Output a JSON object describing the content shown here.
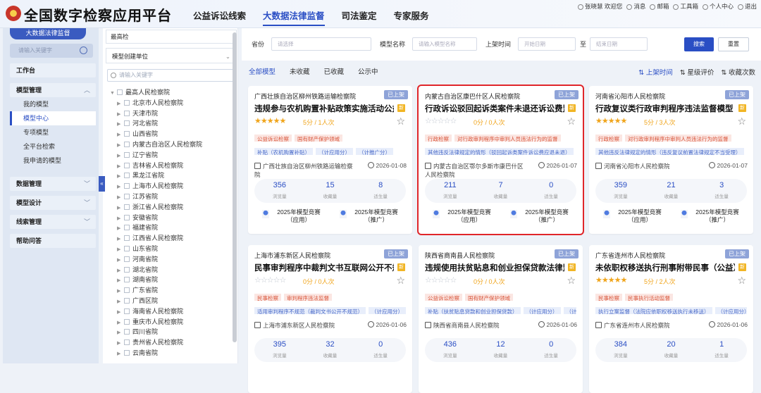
{
  "header": {
    "app_title": "全国数字检察应用平台",
    "nav": [
      "公益诉讼线索",
      "大数据法律监督",
      "司法鉴定",
      "专家服务"
    ],
    "active_nav": 1,
    "user": "张晓慧 欢迎您",
    "links": [
      "消息",
      "邮箱",
      "工具箱",
      "个人中心",
      "退出"
    ]
  },
  "sidebar": {
    "top_label": "大数据法律监督",
    "search_placeholder": "请输入关键字",
    "workbench": "工作台",
    "model_mgmt": "模型管理",
    "model_items": [
      "我的模型",
      "模型中心",
      "专项模型",
      "全平台检索",
      "我申请的模型"
    ],
    "active_item": 1,
    "data_mgmt": "数据管理",
    "model_design": "模型设计",
    "clue_mgmt": "线索管理",
    "help": "帮助问答"
  },
  "tree": {
    "select_value": "最高检",
    "label": "模型创建单位",
    "search_placeholder": "请输入关键字",
    "root": "最高人民检察院",
    "children": [
      "北京市人民检察院",
      "天津市院",
      "河北省院",
      "山西省院",
      "内蒙古自治区人民检察院",
      "辽宁省院",
      "吉林省人民检察院",
      "黑龙江省院",
      "上海市人民检察院",
      "江苏省院",
      "浙江省人民检察院",
      "安徽省院",
      "福建省院",
      "江西省人民检察院",
      "山东省院",
      "河南省院",
      "湖北省院",
      "湖南省院",
      "广东省院",
      "广西区院",
      "海南省人民检察院",
      "重庆市人民检察院",
      "四川省院",
      "贵州省人民检察院",
      "云南省院"
    ]
  },
  "filter": {
    "province_label": "省份",
    "province_placeholder": "请选择",
    "model_name_label": "模型名称",
    "model_name_placeholder": "请输入模型名称",
    "shelf_time_label": "上架时间",
    "start_placeholder": "开始日期",
    "to": "至",
    "end_placeholder": "结束日期",
    "search_btn": "搜索",
    "reset_btn": "重置"
  },
  "tabs": [
    "全部模型",
    "未收藏",
    "已收藏",
    "公示中"
  ],
  "active_tab": 0,
  "sorts": [
    "上架时间",
    "星级评价",
    "收藏次数"
  ],
  "active_sort": 0,
  "stat_labels": [
    "浏览量",
    "收藏量",
    "适生量"
  ],
  "cards": [
    {
      "org": "广西壮族自治区柳州铁路运输检察院",
      "badge": "已上架",
      "title": "违规参与农机购置补贴政策实施活动公益...",
      "stars": 5,
      "score": "5分 / 1人次",
      "tags": [
        "公益诉讼检察",
        "国有财产保护领域"
      ],
      "tags2": [
        "补贴（农机购置补贴）",
        "（计应用分）",
        "（计推广分）"
      ],
      "meta": "广西壮族自治区柳州铁路运输检察院",
      "date": "2026-01-08",
      "stats": [
        "356",
        "15",
        "8"
      ],
      "awards": [
        "2025年模型竞赛（应用）",
        "2025年模型竞赛（推广）"
      ],
      "highlight": false
    },
    {
      "org": "内蒙古自治区康巴什区人民检察院",
      "badge": "已上架",
      "title": "行政诉讼驳回起诉类案件未退还诉讼费监...",
      "stars": 0,
      "score": "0分 / 0人次",
      "tags": [
        "行政检察",
        "对行政审判程序中审判人员违法行为的监督"
      ],
      "tags2": [
        "其他违反法律规定的情形（驳回起诉类案件诉讼费应退未退）"
      ],
      "meta": "内蒙古自治区鄂尔多斯市康巴什区人民检察院",
      "date": "2026-01-07",
      "stats": [
        "211",
        "7",
        "0"
      ],
      "awards": [
        "2025年模型竞赛（应用）",
        "2025年模型竞赛（推广）"
      ],
      "highlight": true
    },
    {
      "org": "河南省沁阳市人民检察院",
      "badge": "已上架",
      "title": "行政复议类行政审判程序违法监督模型",
      "stars": 5,
      "score": "5分 / 3人次",
      "tags": [
        "行政检察",
        "对行政审判程序中审判人员违法行为的监督"
      ],
      "tags2": [
        "其他违反法律规定的情形（违反复议前置法律规定不当受理）"
      ],
      "meta": "河南省沁阳市人民检察院",
      "date": "2026-01-07",
      "stats": [
        "359",
        "21",
        "3"
      ],
      "awards": [
        "2025年模型竞赛（应用）",
        "2025年模型竞赛（推广）"
      ],
      "highlight": false
    },
    {
      "org": "上海市浦东新区人民检察院",
      "badge": "已上架",
      "title": "民事审判程序中裁判文书互联网公开不规...",
      "stars": 0,
      "score": "0分 / 0人次",
      "tags": [
        "民事检察",
        "审判程序违法监督"
      ],
      "tags2": [
        "适用审判程序不规范（裁判文书公开不规范）",
        "（计应用分）"
      ],
      "meta": "上海市浦东新区人民检察院",
      "date": "2026-01-06",
      "stats": [
        "395",
        "32",
        "0"
      ],
      "awards": [],
      "highlight": false
    },
    {
      "org": "陕西省商南县人民检察院",
      "badge": "已上架",
      "title": "违规使用扶贫贴息和创业担保贷款法律监...",
      "stars": 0,
      "score": "0分 / 0人次",
      "tags": [
        "公益诉讼检察",
        "国有财产保护领域"
      ],
      "tags2": [
        "补贴（扶贫贴息贷款和创业担保贷款）",
        "（计应用分）",
        "（计推广分）"
      ],
      "meta": "陕西省商南县人民检察院",
      "date": "2026-01-06",
      "stats": [
        "436",
        "12",
        "0"
      ],
      "awards": [],
      "highlight": false
    },
    {
      "org": "广东省连州市人民检察院",
      "badge": "已上架",
      "title": "未依职权移送执行刑事附带民事（公益）...",
      "stars": 5,
      "score": "5分 / 2人次",
      "tags": [
        "民事检察",
        "民事执行活动监督"
      ],
      "tags2": [
        "执行立案监督（法院应依职权移送执行未移送）",
        "（计应用分）"
      ],
      "meta": "广东省连州市人民检察院",
      "date": "2026-01-06",
      "stats": [
        "384",
        "20",
        "1"
      ],
      "awards": [],
      "highlight": false
    }
  ]
}
